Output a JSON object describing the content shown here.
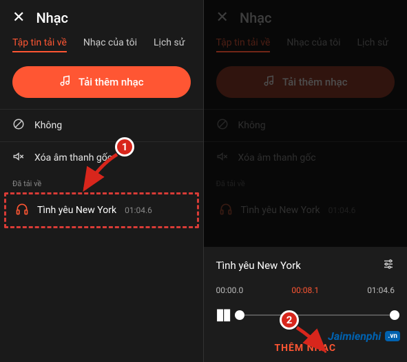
{
  "left": {
    "title": "Nhạc",
    "tabs": {
      "downloads": "Tập tin tải về",
      "mine": "Nhạc của tôi",
      "history": "Lịch sử"
    },
    "primary_button": "Tải thêm nhạc",
    "options": {
      "none": "Không",
      "remove_original": "Xóa âm thanh gốc"
    },
    "section_label": "Đã tải về",
    "track": {
      "name": "Tình yêu New York",
      "duration": "01:04.6"
    }
  },
  "right": {
    "title": "Nhạc",
    "tabs": {
      "downloads": "Tập tin tải về",
      "mine": "Nhạc của tôi",
      "history": "Lịch sử"
    },
    "primary_button": "Tải thêm nhạc",
    "options": {
      "none": "Không",
      "remove_original": "Xóa âm thanh gốc"
    },
    "section_label": "Đã tải về",
    "track": {
      "name": "Tình yêu New York",
      "duration": "01:04.6"
    },
    "player": {
      "title": "Tình yêu New York",
      "start": "00:00.0",
      "current": "00:08.1",
      "end": "01:04.6",
      "cta": "THÊM NHẠC"
    }
  },
  "callouts": {
    "badge1": "1",
    "badge2": "2"
  },
  "watermark": {
    "part1": "Jaimienphi",
    "suffix": ".vn"
  }
}
